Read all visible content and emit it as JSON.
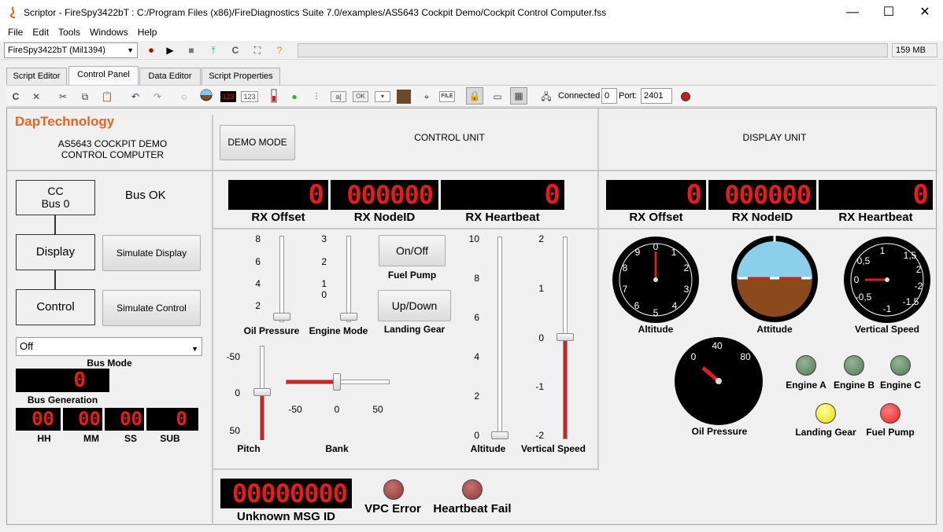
{
  "window": {
    "title": "Scriptor - FireSpy3422bT : C:/Program Files (x86)/FireDiagnostics Suite 7.0/examples/AS5643 Cockpit Demo/Cockpit Control Computer.fss",
    "minimize": "—",
    "maximize": "☐",
    "close": "✕"
  },
  "menu": [
    "File",
    "Edit",
    "Tools",
    "Windows",
    "Help"
  ],
  "toolbar": {
    "device": "FireSpy3422bT (Mil1394)",
    "memory": "159 MB",
    "c_label": "C"
  },
  "tabs": [
    "Script Editor",
    "Control Panel",
    "Data Editor",
    "Script Properties"
  ],
  "toolbar2": {
    "connected_label": "Connected",
    "connected_value": "0",
    "port_label": "Port:",
    "port_value": "2401",
    "lcd_sample": "123",
    "num_sample": "123",
    "ok_sample": "OK",
    "file_sample": "FILE",
    "ab_sample": "a|"
  },
  "header": {
    "brand": "DapTechnology",
    "subtitle": "AS5643 COCKPIT DEMO\nCONTROL COMPUTER",
    "demo_mode": "DEMO MODE",
    "control_unit": "CONTROL UNIT",
    "display_unit": "DISPLAY UNIT"
  },
  "left": {
    "cc_box": "CC\nBus 0",
    "bus_status": "Bus OK",
    "display_box": "Display",
    "control_box": "Control",
    "simulate_display": "Simulate Display",
    "simulate_control": "Simulate Control",
    "bus_mode_value": "Off",
    "bus_mode_label": "Bus Mode",
    "bus_generation_value": "0",
    "bus_generation_label": "Bus Generation",
    "time": {
      "hh": "00",
      "mm": "00",
      "ss": "00",
      "sub": "0",
      "hh_label": "HH",
      "mm_label": "MM",
      "ss_label": "SS",
      "sub_label": "SUB"
    }
  },
  "control_unit": {
    "rx_offset": "0",
    "rx_nodeid": "000000",
    "rx_heartbeat": "0",
    "rx_offset_label": "RX Offset",
    "rx_nodeid_label": "RX NodeID",
    "rx_heartbeat_label": "RX Heartbeat",
    "oil_pressure": {
      "label": "Oil Pressure",
      "ticks": [
        "8",
        "6",
        "4",
        "2"
      ],
      "value": 0
    },
    "engine_mode": {
      "label": "Engine Mode",
      "ticks": [
        "3",
        "2",
        "1",
        "0"
      ],
      "value": 0
    },
    "fuel_pump": {
      "button": "On/Off",
      "label": "Fuel Pump"
    },
    "landing_gear": {
      "button": "Up/Down",
      "label": "Landing Gear"
    },
    "altitude": {
      "label": "Altitude",
      "ticks": [
        "10",
        "8",
        "6",
        "4",
        "2",
        "0"
      ],
      "value": 0
    },
    "vertical_speed": {
      "label": "Vertical Speed",
      "ticks": [
        "2",
        "1",
        "0",
        "-1",
        "-2"
      ],
      "value": 0
    },
    "pitch": {
      "label": "Pitch",
      "ticks": [
        "-50",
        "0",
        "50"
      ],
      "value": 0
    },
    "bank": {
      "label": "Bank",
      "ticks": [
        "-50",
        "0",
        "50"
      ],
      "value": 0
    },
    "unknown_msg_id": "00000000",
    "unknown_msg_label": "Unknown MSG ID",
    "vpc_error": "VPC Error",
    "heartbeat_fail": "Heartbeat Fail"
  },
  "display_unit": {
    "rx_offset": "0",
    "rx_nodeid": "000000",
    "rx_heartbeat": "0",
    "rx_offset_label": "RX Offset",
    "rx_nodeid_label": "RX NodeID",
    "rx_heartbeat_label": "RX Heartbeat",
    "altitude_gauge": {
      "label": "Altitude",
      "numbers": [
        "0",
        "1",
        "2",
        "3",
        "4",
        "5",
        "6",
        "7",
        "8",
        "9"
      ]
    },
    "attitude_gauge": {
      "label": "Attitude"
    },
    "vs_gauge": {
      "label": "Vertical Speed",
      "numbers": [
        "1",
        "1,5",
        "2",
        "-1,5",
        "-1",
        "-0,5",
        "0",
        "0,5",
        "-2"
      ]
    },
    "oil_gauge": {
      "label": "Oil Pressure",
      "numbers": [
        "0",
        "40",
        "80"
      ]
    },
    "indicators": [
      {
        "label": "Engine A",
        "color": "#4f7a4f"
      },
      {
        "label": "Engine B",
        "color": "#4f7a4f"
      },
      {
        "label": "Engine C",
        "color": "#4f7a4f"
      },
      {
        "label": "Landing Gear",
        "color": "#e8e000"
      },
      {
        "label": "Fuel Pump",
        "color": "#e82020"
      }
    ]
  },
  "colors": {
    "accent": "#e8641e",
    "lcd_red": "#e61c1c",
    "slider_red": "#d42020"
  }
}
